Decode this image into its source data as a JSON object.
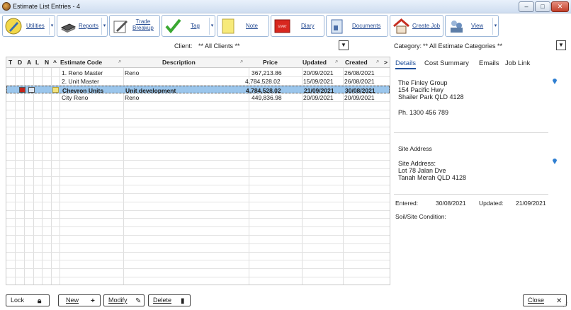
{
  "window": {
    "title": "Estimate List Entries - 4"
  },
  "toolbar": {
    "utilities": "Utilities",
    "reports": "Reports",
    "trade_breakup_1": "Trade",
    "trade_breakup_2": "Breakup",
    "tag": "Tag",
    "note": "Note",
    "diary": "Diary",
    "documents": "Documents",
    "create_job": "Create Job",
    "view": "View"
  },
  "filters": {
    "client_label": "Client:",
    "client_value": "** All Clients **",
    "category_label": "Category:",
    "category_value": "** All Estimate Categories **"
  },
  "grid": {
    "headers": {
      "t": "T",
      "d": "D",
      "a": "A",
      "l": "L",
      "n": "N",
      "code": "Estimate Code",
      "description": "Description",
      "price": "Price",
      "updated": "Updated",
      "created": "Created"
    },
    "rows": [
      {
        "code": "1. Reno Master",
        "description": "Reno",
        "price": "367,213.86",
        "updated": "20/09/2021",
        "created": "26/08/2021",
        "selected": false
      },
      {
        "code": "2. Unit Master",
        "description": "",
        "price": "4,784,528.02",
        "updated": "15/09/2021",
        "created": "26/08/2021",
        "selected": false
      },
      {
        "code": "Chevron Units",
        "description": "Unit development",
        "price": "4,784,528.02",
        "updated": "21/09/2021",
        "created": "30/08/2021",
        "selected": true
      },
      {
        "code": "City Reno",
        "description": "Reno",
        "price": "449,836.98",
        "updated": "20/09/2021",
        "created": "20/09/2021",
        "selected": false
      }
    ]
  },
  "details": {
    "tabs": [
      "Details",
      "Cost Summary",
      "Emails",
      "Job Link"
    ],
    "client_name": "The Finley Group",
    "client_addr1": "154 Pacific Hwy",
    "client_addr2": "Shailer Park QLD 4128",
    "phone": "Ph. 1300 456 789",
    "site_heading": "Site Address",
    "site_label": "Site Address:",
    "site_addr1": "Lot 78 Jalan Dve",
    "site_addr2": "Tanah Merah QLD 4128",
    "entered_label": "Entered:",
    "entered_value": "30/08/2021",
    "updated_label": "Updated:",
    "updated_value": "21/09/2021",
    "soil_label": "Soil/Site Condition:"
  },
  "buttons": {
    "lock": "Lock",
    "new": "New",
    "modify": "Modify",
    "delete": "Delete",
    "close": "Close"
  }
}
